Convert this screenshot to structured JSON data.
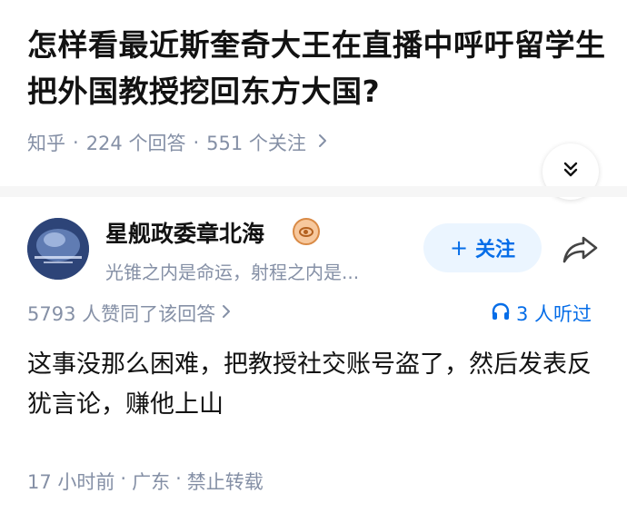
{
  "question": {
    "title": "怎样看最近斯奎奇大王在直播中呼吁留学生把外国教授挖回东方大国?",
    "platform": "知乎",
    "answer_count": "224 个回答",
    "follower_count": "551 个关注",
    "separator": "·"
  },
  "author": {
    "name": "星舰政委章北海",
    "bio": "光锥之内是命运，射程之内是...",
    "follow_label": "关注",
    "follow_plus": "+"
  },
  "stats": {
    "votes": "5793 人赞同了该回答",
    "listens": "3 人听过"
  },
  "answer": {
    "content": "这事没那么困难，把教授社交账号盗了，然后发表反犹言论，赚他上山",
    "time": "17 小时前",
    "location": "广东",
    "copyright": "禁止转载",
    "separator": "·"
  },
  "icons": {
    "collapse": "double-chevron-down-icon",
    "share": "share-icon",
    "headphones": "headphones-icon",
    "badge": "certification-badge-icon"
  },
  "colors": {
    "accent": "#056de8",
    "follow_bg": "#ebf5ff",
    "meta_text": "#8590a6",
    "title_text": "#121212"
  }
}
